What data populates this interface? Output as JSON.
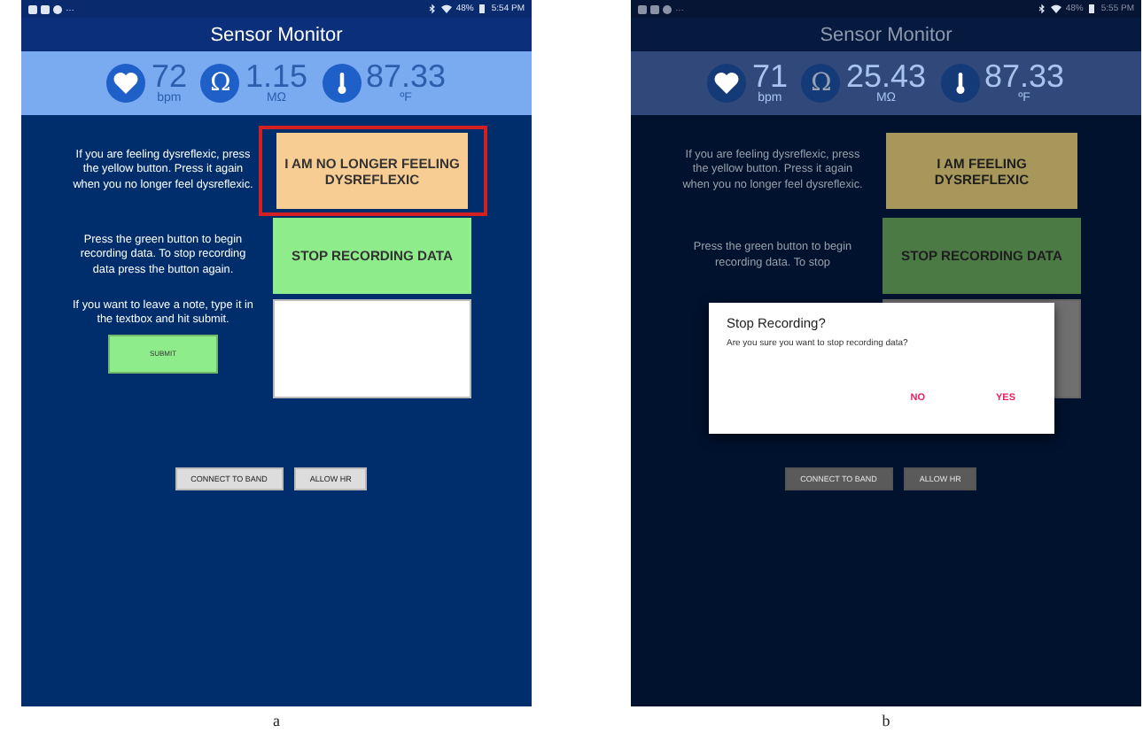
{
  "panels": [
    {
      "caption": "a",
      "status_bar": {
        "overflow": "…",
        "battery": "48%",
        "time": "5:54 PM"
      },
      "title": "Sensor Monitor",
      "readings": [
        {
          "kind": "heart",
          "value": "72",
          "unit": "bpm"
        },
        {
          "kind": "resistance",
          "symbol": "Ω",
          "value": "1.15",
          "unit": "MΩ"
        },
        {
          "kind": "temperature",
          "value": "87.33",
          "unit": "ºF"
        }
      ],
      "alert_text": "If you are feeling dysreflexic, press the yellow button. Press it again when you no longer feel dysreflexic.",
      "alert_button": {
        "label": "I AM NO LONGER FEELING DYSREFLEXIC",
        "active": true,
        "highlighted": true
      },
      "record_text": "Press the green button to begin recording data. To stop recording data press the button again.",
      "record_button": "STOP RECORDING DATA",
      "note_text": "If you want to leave a note, type it in the textbox and hit submit.",
      "submit_button": "SUBMIT",
      "buttons": [
        "CONNECT TO BAND",
        "ALLOW HR"
      ]
    },
    {
      "caption": "b",
      "status_bar": {
        "overflow": "…",
        "battery": "48%",
        "time": "5:55 PM"
      },
      "title": "Sensor Monitor",
      "readings": [
        {
          "kind": "heart",
          "value": "71",
          "unit": "bpm"
        },
        {
          "kind": "resistance",
          "symbol": "Ω",
          "value": "25.43",
          "unit": "MΩ"
        },
        {
          "kind": "temperature",
          "value": "87.33",
          "unit": "ºF"
        }
      ],
      "alert_text": "If you are feeling dysreflexic, press the yellow button. Press it again when you no longer feel dysreflexic.",
      "alert_button": {
        "label": "I AM FEELING DYSREFLEXIC",
        "active": false,
        "highlighted": false
      },
      "record_text": "Press the green button to begin recording data. To stop",
      "record_button": "STOP RECORDING DATA",
      "buttons": [
        "CONNECT TO BAND",
        "ALLOW HR"
      ],
      "dialog": {
        "title": "Stop Recording?",
        "message": "Are you sure you want to stop recording data?",
        "buttons": [
          "NO",
          "YES"
        ]
      }
    }
  ]
}
